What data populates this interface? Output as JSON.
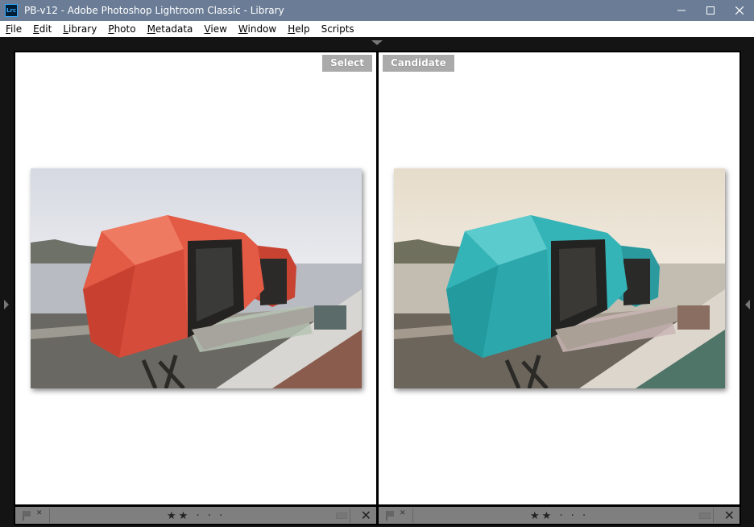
{
  "window": {
    "app_icon_text": "Lrc",
    "title": "PB-v12 - Adobe Photoshop Lightroom Classic - Library",
    "minimize": "—",
    "maximize": "☐",
    "close": "✕"
  },
  "menu": [
    {
      "label": "File",
      "ul": "F",
      "rest": "ile"
    },
    {
      "label": "Edit",
      "ul": "E",
      "rest": "dit"
    },
    {
      "label": "Library",
      "ul": "L",
      "rest": "ibrary"
    },
    {
      "label": "Photo",
      "ul": "P",
      "rest": "hoto"
    },
    {
      "label": "Metadata",
      "ul": "M",
      "rest": "etadata"
    },
    {
      "label": "View",
      "ul": "V",
      "rest": "iew"
    },
    {
      "label": "Window",
      "ul": "W",
      "rest": "indow"
    },
    {
      "label": "Help",
      "ul": "H",
      "rest": "elp"
    },
    {
      "label": "Scripts",
      "ul": "",
      "rest": "Scripts"
    }
  ],
  "compare": {
    "left": {
      "label": "Select",
      "image": "red geometric pod building by the water",
      "stars": "★★ · · ·",
      "rating": 2
    },
    "right": {
      "label": "Candidate",
      "image": "teal geometric pod building by the water (sepia toned)",
      "stars": "★★ · · ·",
      "rating": 2
    }
  },
  "colors": {
    "titlebar": "#6b7d96",
    "pod_left": "#e35a45",
    "pod_right": "#35b4b8"
  },
  "icons": {
    "flag": "flag-icon",
    "reject": "reject-flag-icon",
    "close": "close-icon"
  },
  "footer_close": "✕",
  "reject_mark": "✕"
}
